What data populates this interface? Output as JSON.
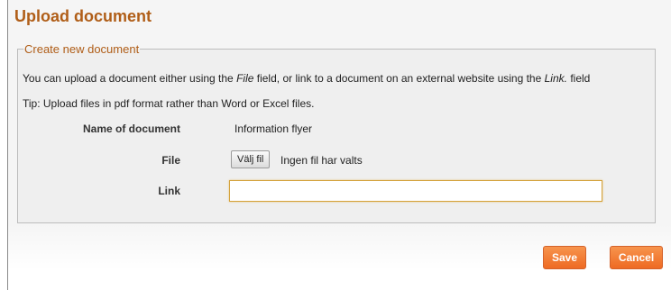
{
  "page": {
    "title": "Upload document"
  },
  "form": {
    "legend": "Create new document",
    "intro": {
      "part1": "You can upload a document either using the ",
      "file_word": "File",
      "part2": " field, or link to a document on an external website using the ",
      "link_word": "Link.",
      "part3": " field"
    },
    "tip": "Tip: Upload files in pdf format rather than Word or Excel files.",
    "name": {
      "label": "Name of document",
      "value": "Information flyer"
    },
    "file": {
      "label": "File",
      "button_label": "Välj fil",
      "status": "Ingen fil har valts"
    },
    "link": {
      "label": "Link",
      "value": ""
    }
  },
  "actions": {
    "save_label": "Save",
    "cancel_label": "Cancel"
  },
  "colors": {
    "title": "#b05e18",
    "button": "#ee6a23",
    "panel_bg": "#efefef"
  }
}
